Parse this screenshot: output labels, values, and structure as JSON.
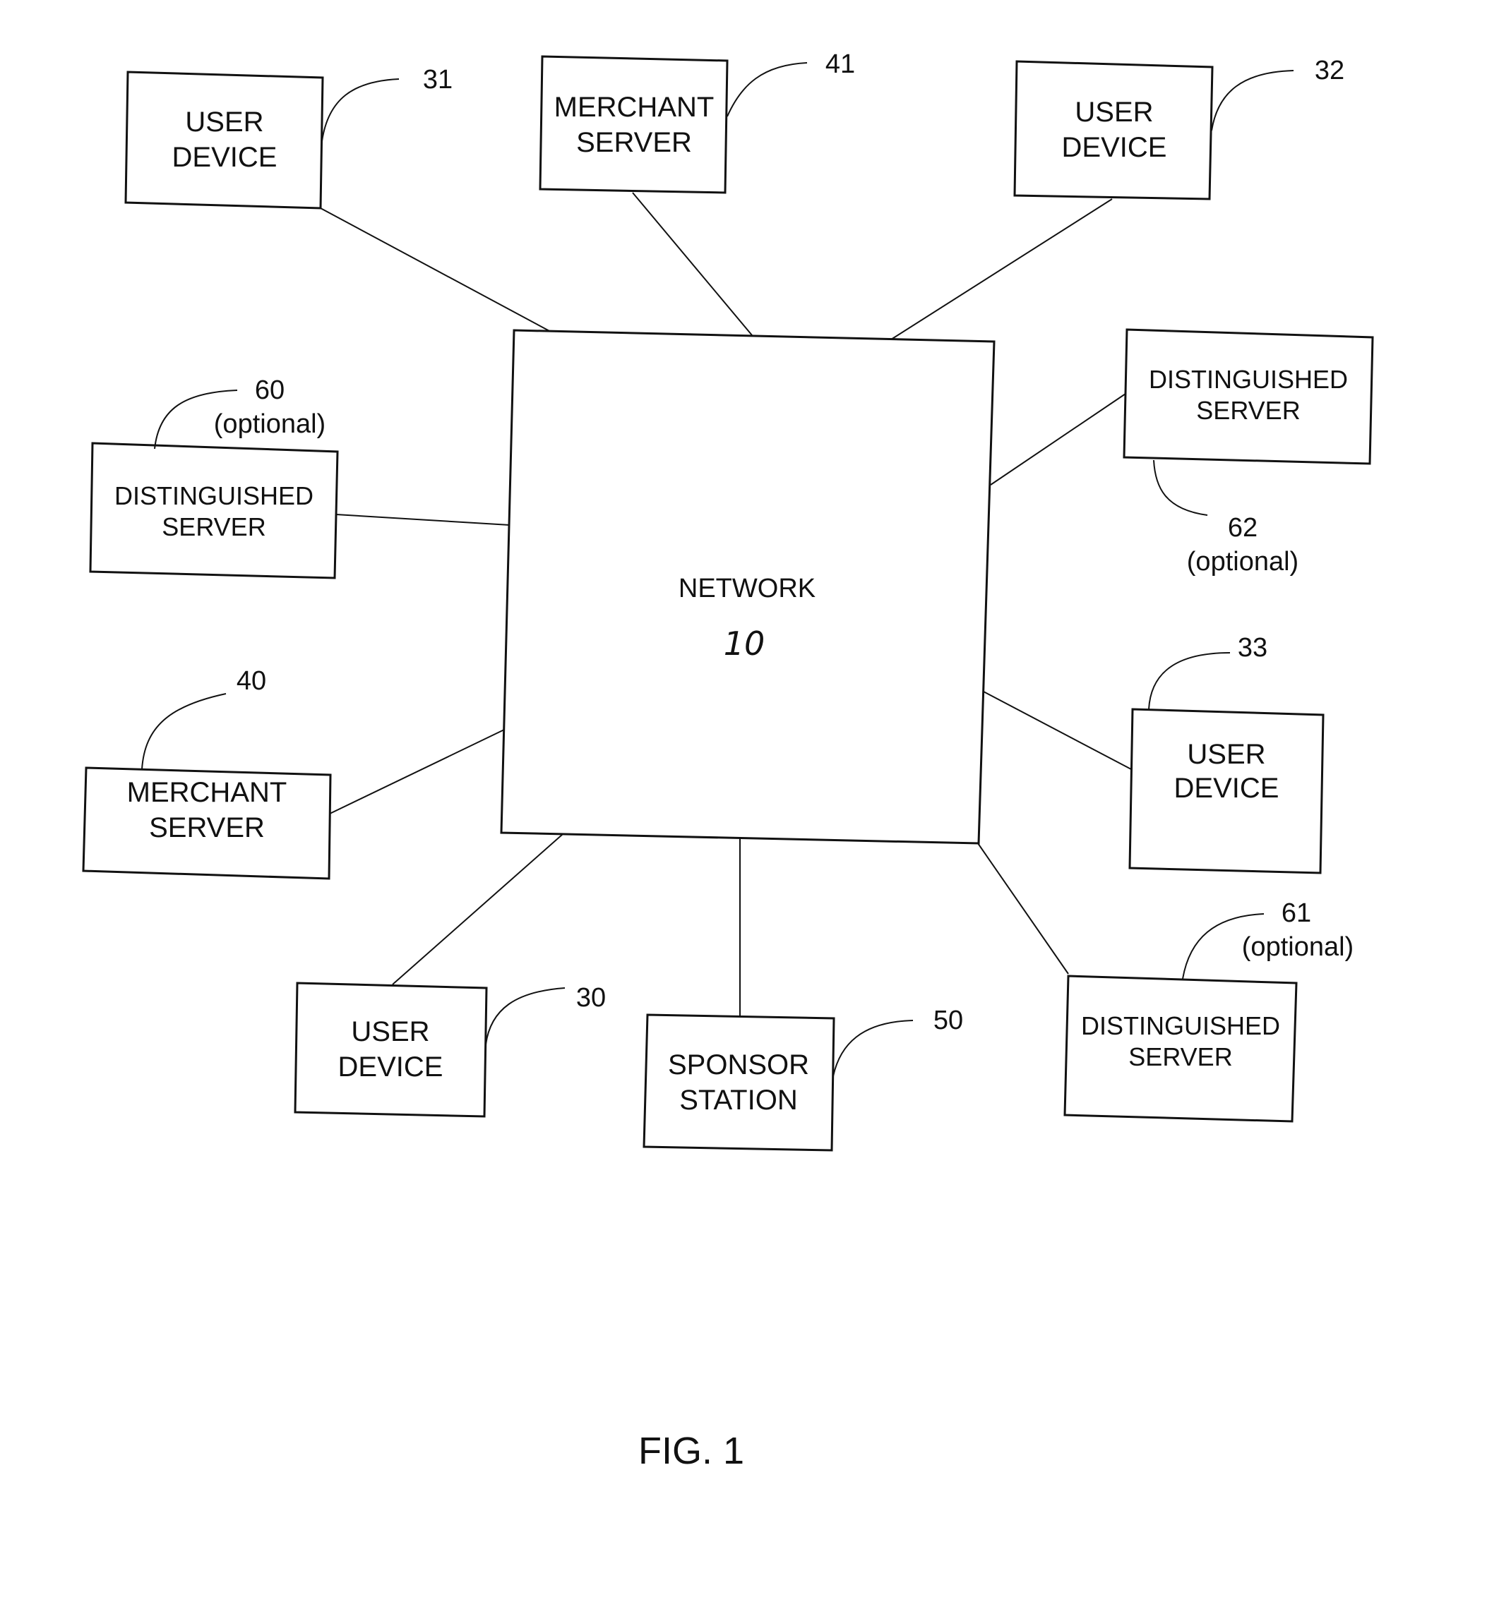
{
  "figure": {
    "caption": "FIG. 1"
  },
  "network": {
    "label": "NETWORK",
    "ref": "10"
  },
  "nodes": [
    {
      "id": "user-device-31",
      "line1": "USER",
      "line2": "DEVICE",
      "ref": "31",
      "note": ""
    },
    {
      "id": "merchant-server-41",
      "line1": "MERCHANT",
      "line2": "SERVER",
      "ref": "41",
      "note": ""
    },
    {
      "id": "user-device-32",
      "line1": "USER",
      "line2": "DEVICE",
      "ref": "32",
      "note": ""
    },
    {
      "id": "distinguished-server-62",
      "line1": "DISTINGUISHED",
      "line2": "SERVER",
      "ref": "62",
      "note": "(optional)"
    },
    {
      "id": "distinguished-server-60",
      "line1": "DISTINGUISHED",
      "line2": "SERVER",
      "ref": "60",
      "note": "(optional)"
    },
    {
      "id": "user-device-33",
      "line1": "USER",
      "line2": "DEVICE",
      "ref": "33",
      "note": ""
    },
    {
      "id": "merchant-server-40",
      "line1": "MERCHANT",
      "line2": "SERVER",
      "ref": "40",
      "note": ""
    },
    {
      "id": "user-device-30",
      "line1": "USER",
      "line2": "DEVICE",
      "ref": "30",
      "note": ""
    },
    {
      "id": "sponsor-station-50",
      "line1": "SPONSOR",
      "line2": "STATION",
      "ref": "50",
      "note": ""
    },
    {
      "id": "distinguished-server-61",
      "line1": "DISTINGUISHED",
      "line2": "SERVER",
      "ref": "61",
      "note": "(optional)"
    }
  ]
}
